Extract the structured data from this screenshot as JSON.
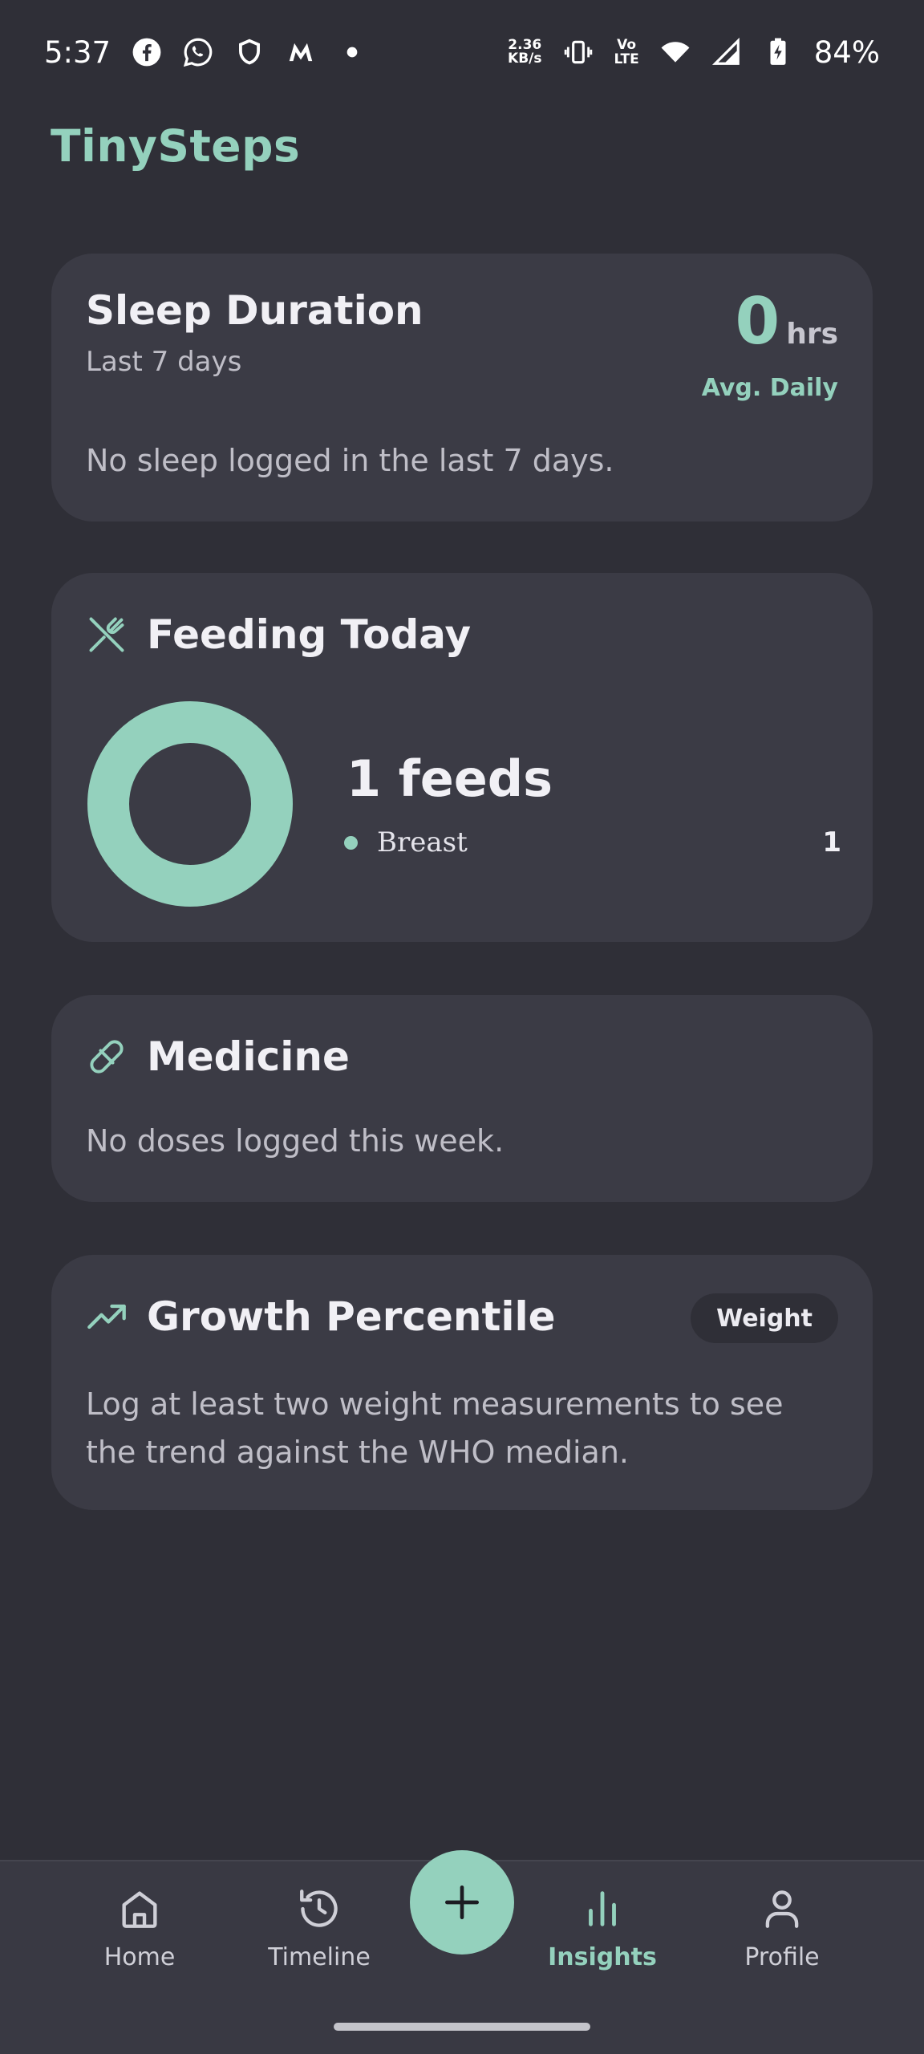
{
  "status_bar": {
    "time": "5:37",
    "net_speed_value": "2.36",
    "net_speed_unit": "KB/s",
    "volte_top": "Vo",
    "volte_bottom": "LTE",
    "battery_pct": "84%",
    "icons": [
      "facebook-icon",
      "whatsapp-icon",
      "shield-icon",
      "myntra-icon",
      "dot-icon",
      "vibrate-icon",
      "wifi-icon",
      "signal-icon",
      "battery-charging-icon"
    ]
  },
  "app": {
    "title": "TinySteps",
    "accent_color": "#94d1bd"
  },
  "sleep": {
    "title": "Sleep Duration",
    "subtitle": "Last 7 days",
    "value": "0",
    "unit": "hrs",
    "avg_label": "Avg. Daily",
    "empty_text": "No sleep logged in the last 7 days."
  },
  "feeding": {
    "title": "Feeding Today",
    "icon": "utensils-icon",
    "count_text": "1 feeds",
    "breakdown": [
      {
        "label": "Breast",
        "value": "1",
        "color": "#94d1bd"
      }
    ]
  },
  "medicine": {
    "title": "Medicine",
    "icon": "pill-icon",
    "empty_text": "No doses logged this week."
  },
  "growth": {
    "title": "Growth Percentile",
    "icon": "trending-up-icon",
    "chip_label": "Weight",
    "empty_text": "Log at least two weight measurements to see the trend against the WHO median."
  },
  "bottom_nav": {
    "items": [
      {
        "label": "Home",
        "icon": "home-icon",
        "active": false
      },
      {
        "label": "Timeline",
        "icon": "history-icon",
        "active": false
      },
      {
        "label": "Insights",
        "icon": "bar-chart-icon",
        "active": true
      },
      {
        "label": "Profile",
        "icon": "person-icon",
        "active": false
      }
    ],
    "fab_icon": "plus-icon"
  }
}
